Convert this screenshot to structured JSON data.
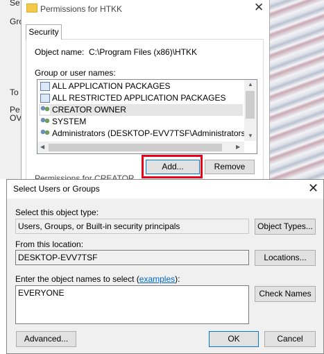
{
  "background_window": {
    "labels": [
      "Se",
      "Gro",
      "To",
      "Pe",
      "OV"
    ]
  },
  "permissions": {
    "title": "Permissions for HTKK",
    "tab_security": "Security",
    "object_name_label": "Object name:",
    "object_name_value": "C:\\Program Files (x86)\\HTKK",
    "group_label": "Group or user names:",
    "principals": [
      {
        "name": "ALL APPLICATION PACKAGES",
        "icon": "package-icon"
      },
      {
        "name": "ALL RESTRICTED APPLICATION PACKAGES",
        "icon": "package-icon"
      },
      {
        "name": "CREATOR OWNER",
        "icon": "users-icon",
        "selected": true
      },
      {
        "name": "SYSTEM",
        "icon": "users-icon"
      },
      {
        "name": "Administrators (DESKTOP-EVV7TSF\\Administrators)",
        "icon": "users-icon"
      }
    ],
    "add_button": "Add...",
    "remove_button": "Remove",
    "partial_label": "Permissions for CREATOR"
  },
  "select_dialog": {
    "title": "Select Users or Groups",
    "object_type_label": "Select this object type:",
    "object_type_value": "Users, Groups, or Built-in security principals",
    "object_types_button": "Object Types...",
    "location_label": "From this location:",
    "location_value": "DESKTOP-EVV7TSF",
    "locations_button": "Locations...",
    "names_label_prefix": "Enter the object names to select (",
    "names_label_link": "examples",
    "names_label_suffix": "):",
    "names_value": "EVERYONE",
    "check_names_button": "Check Names",
    "advanced_button": "Advanced...",
    "ok_button": "OK",
    "cancel_button": "Cancel"
  },
  "colors": {
    "highlight_box": "#e3001b",
    "focus_border": "#0078d7",
    "link": "#0066cc"
  }
}
